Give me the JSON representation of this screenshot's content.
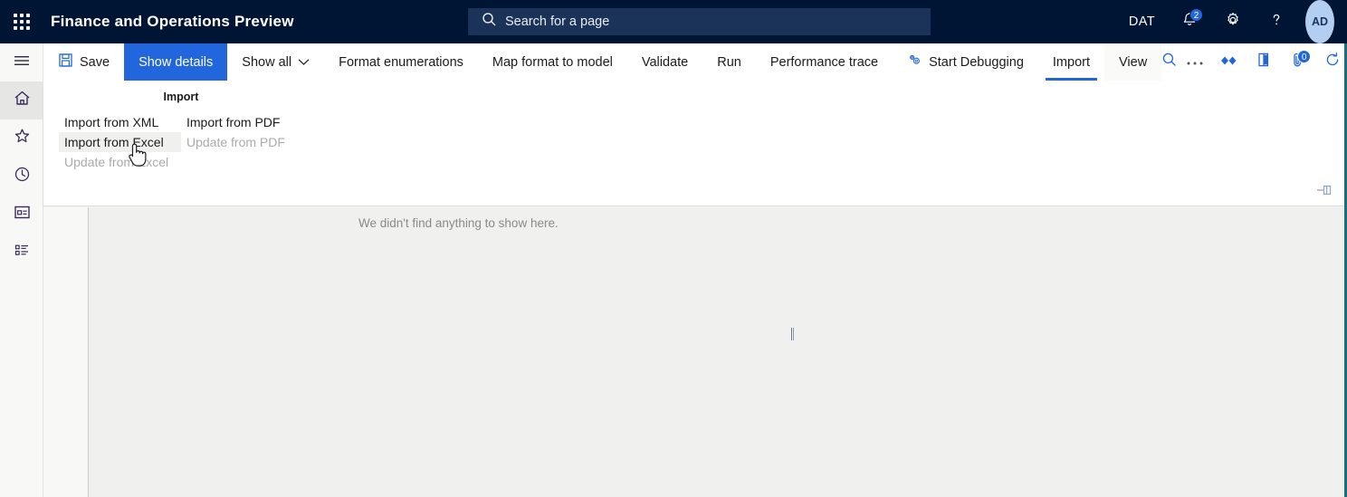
{
  "topbar": {
    "waffle_icon": "app-launcher-icon",
    "title": "Finance and Operations Preview",
    "search": {
      "icon": "search-icon",
      "placeholder": "Search for a page",
      "value": ""
    },
    "company_label": "DAT",
    "notifications": {
      "icon": "bell-icon",
      "count": "2"
    },
    "settings_icon": "gear-icon",
    "help_icon": "question-mark-icon",
    "avatar_initials": "AD"
  },
  "rail": {
    "items": [
      {
        "icon": "hamburger-menu-icon",
        "name": "navigation-menu"
      },
      {
        "icon": "home-icon",
        "name": "home",
        "active": true
      },
      {
        "icon": "star-icon",
        "name": "favorites"
      },
      {
        "icon": "clock-icon",
        "name": "recent"
      },
      {
        "icon": "workspaces-icon",
        "name": "workspaces"
      },
      {
        "icon": "modules-list-icon",
        "name": "modules"
      }
    ]
  },
  "action_pane": {
    "buttons": [
      {
        "label": "Save",
        "icon": "save-floppy-icon",
        "style": "default"
      },
      {
        "label": "Show details",
        "icon": "",
        "style": "primary"
      },
      {
        "label": "Show all",
        "icon": "chevron-down-icon",
        "style": "default"
      },
      {
        "label": "Format enumerations",
        "icon": "",
        "style": "default"
      },
      {
        "label": "Map format to model",
        "icon": "",
        "style": "default"
      },
      {
        "label": "Validate",
        "icon": "",
        "style": "default"
      },
      {
        "label": "Run",
        "icon": "",
        "style": "default"
      },
      {
        "label": "Performance trace",
        "icon": "",
        "style": "default"
      },
      {
        "label": "Start Debugging",
        "icon": "gears-icon",
        "style": "default"
      }
    ],
    "tabs": [
      {
        "label": "Import",
        "active": true
      },
      {
        "label": "View",
        "active": false
      }
    ],
    "icons": [
      {
        "name": "search-icon",
        "badge": ""
      },
      {
        "name": "overflow-ellipsis-icon",
        "badge": ""
      },
      {
        "name": "open-in-office-icon",
        "badge": ""
      },
      {
        "name": "office-app-icon",
        "badge": ""
      },
      {
        "name": "attachments-icon",
        "badge": "0"
      },
      {
        "name": "refresh-icon",
        "badge": ""
      },
      {
        "name": "open-in-new-window-icon",
        "badge": ""
      },
      {
        "name": "close-icon",
        "badge": ""
      }
    ]
  },
  "flyout": {
    "group_title": "Import",
    "columns": [
      {
        "items": [
          {
            "label": "Import from XML",
            "state": "normal"
          },
          {
            "label": "Import from Excel",
            "state": "hover"
          },
          {
            "label": "Update from Excel",
            "state": "disabled"
          }
        ]
      },
      {
        "items": [
          {
            "label": "Import from PDF",
            "state": "normal"
          },
          {
            "label": "Update from PDF",
            "state": "disabled"
          }
        ]
      }
    ],
    "pin_icon": "pin-action-pane-icon"
  },
  "content": {
    "empty_message": "We didn't find anything to show here."
  },
  "colors": {
    "topbar_bg": "#001433",
    "accent": "#2266dd",
    "search_bg": "#1b3259",
    "avatar_bg": "#b3cef0",
    "content_bg": "#f0f0ef",
    "rail_bg": "#f8f8f7"
  }
}
